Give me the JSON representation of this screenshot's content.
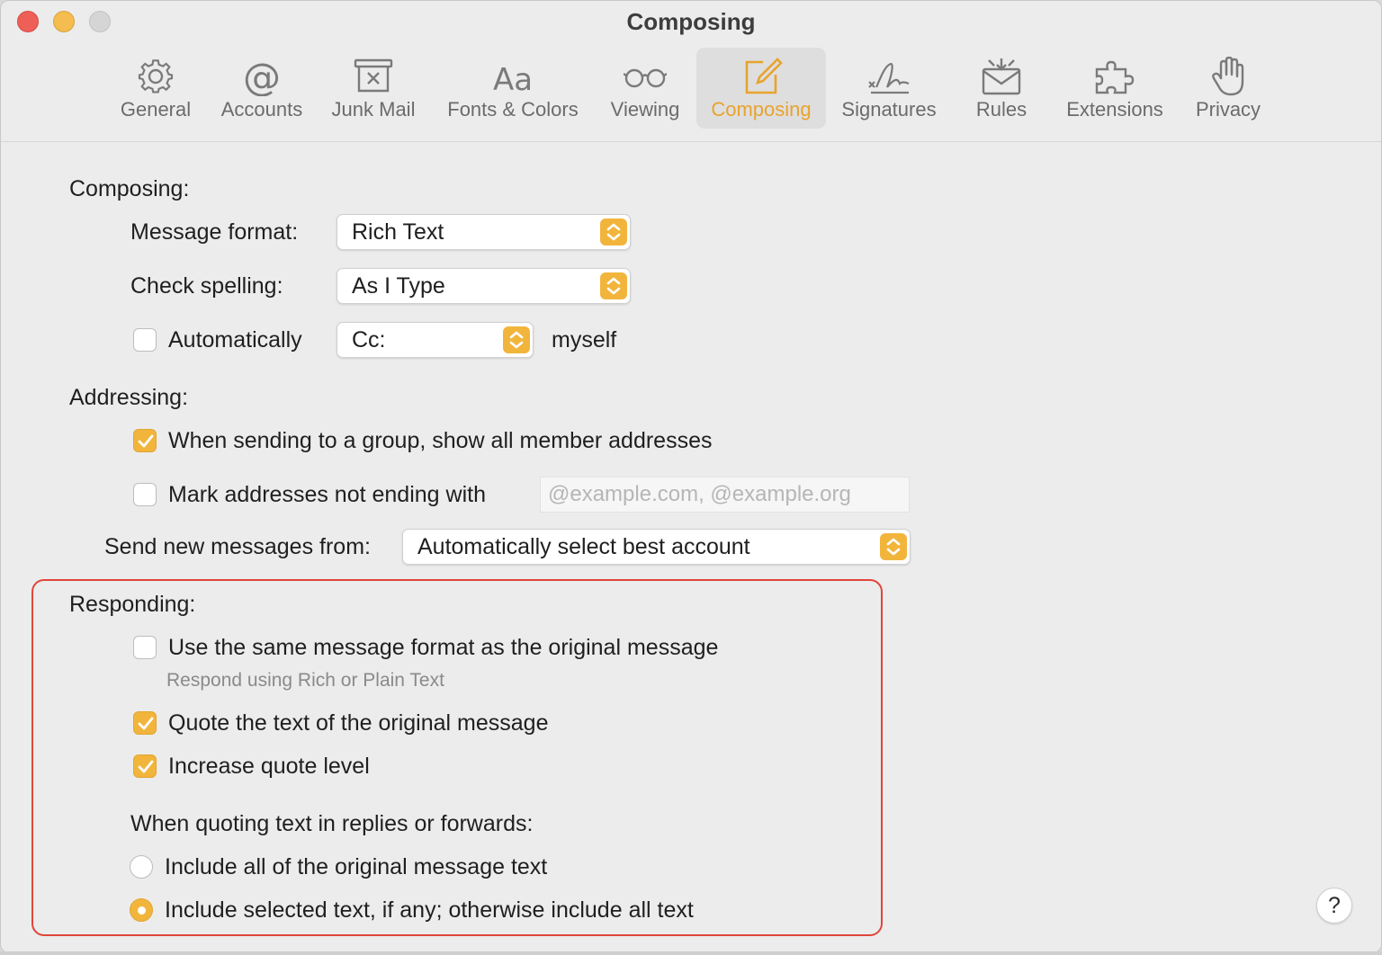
{
  "window": {
    "title": "Composing"
  },
  "toolbar": {
    "tabs": [
      {
        "label": "General",
        "icon": "gear-icon"
      },
      {
        "label": "Accounts",
        "icon": "at-icon"
      },
      {
        "label": "Junk Mail",
        "icon": "junk-mail-icon"
      },
      {
        "label": "Fonts & Colors",
        "icon": "fonts-icon"
      },
      {
        "label": "Viewing",
        "icon": "glasses-icon"
      },
      {
        "label": "Composing",
        "icon": "compose-icon",
        "active": true
      },
      {
        "label": "Signatures",
        "icon": "signature-icon"
      },
      {
        "label": "Rules",
        "icon": "rules-icon"
      },
      {
        "label": "Extensions",
        "icon": "puzzle-icon"
      },
      {
        "label": "Privacy",
        "icon": "hand-icon"
      }
    ]
  },
  "composing": {
    "header": "Composing:",
    "message_format_label": "Message format:",
    "message_format_value": "Rich Text",
    "check_spelling_label": "Check spelling:",
    "check_spelling_value": "As I Type",
    "auto_cc": {
      "checked": false,
      "label": "Automatically",
      "select_value": "Cc:",
      "suffix": "myself"
    }
  },
  "addressing": {
    "header": "Addressing:",
    "show_group_members": {
      "checked": true,
      "label": "When sending to a group, show all member addresses"
    },
    "mark_addresses": {
      "checked": false,
      "label": "Mark addresses not ending with",
      "placeholder": "@example.com, @example.org"
    },
    "send_from_label": "Send new messages from:",
    "send_from_value": "Automatically select best account"
  },
  "responding": {
    "header": "Responding:",
    "same_format": {
      "checked": false,
      "label": "Use the same message format as the original message",
      "sublabel": "Respond using Rich or Plain Text"
    },
    "quote_text": {
      "checked": true,
      "label": "Quote the text of the original message"
    },
    "increase_quote": {
      "checked": true,
      "label": "Increase quote level"
    },
    "quoting_label": "When quoting text in replies or forwards:",
    "include_all": {
      "selected": false,
      "label": "Include all of the original message text"
    },
    "include_selected": {
      "selected": true,
      "label": "Include selected text, if any; otherwise include all text"
    }
  },
  "help_button": "?",
  "colors": {
    "accent": "#f2b53c",
    "highlight_border": "#e0453a",
    "active_tab_text": "#e8a32e"
  }
}
